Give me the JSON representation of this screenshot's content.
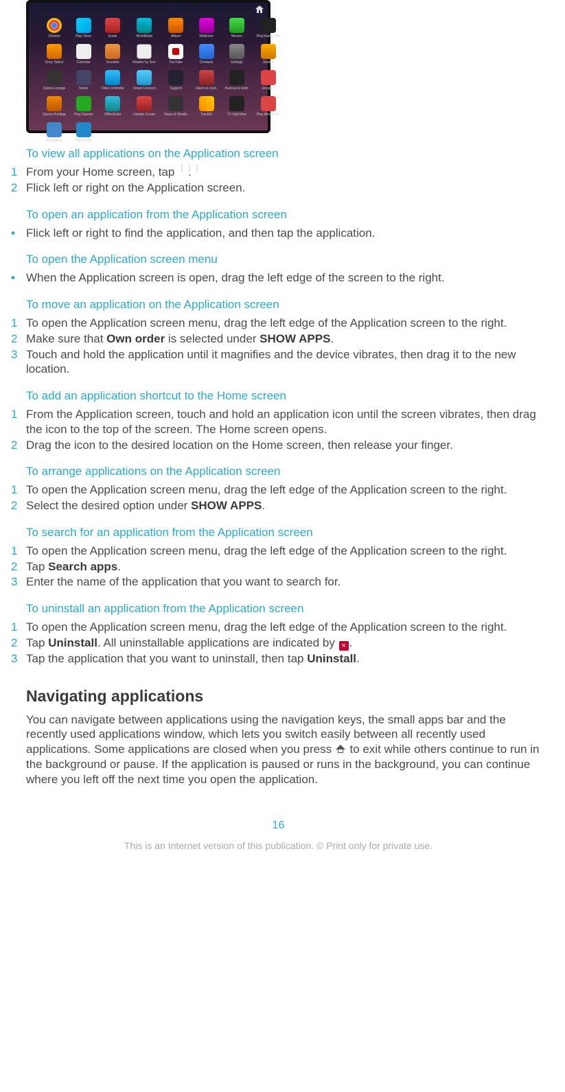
{
  "screenshot": {
    "apps": [
      {
        "label": "Chrome",
        "cls": "ico-chrome"
      },
      {
        "label": "Play Store",
        "cls": "ico-play"
      },
      {
        "label": "Email",
        "cls": "ico-email"
      },
      {
        "label": "WorldMate",
        "cls": "ico-worldmate"
      },
      {
        "label": "Album",
        "cls": "ico-album"
      },
      {
        "label": "Walkman",
        "cls": "ico-walkman"
      },
      {
        "label": "Movies",
        "cls": "ico-movies"
      },
      {
        "label": "PlayStation Mobile",
        "cls": "ico-psmobile"
      },
      {
        "label": "Sony Select",
        "cls": "ico-sonysel"
      },
      {
        "label": "Calendar",
        "cls": "ico-calendar"
      },
      {
        "label": "Socialife",
        "cls": "ico-socialife"
      },
      {
        "label": "Reader by Sony",
        "cls": "ico-ebook"
      },
      {
        "label": "YouTube",
        "cls": "ico-youtube"
      },
      {
        "label": "Contacts",
        "cls": "ico-contacts"
      },
      {
        "label": "Settings",
        "cls": "ico-settings"
      },
      {
        "label": "Sketch",
        "cls": "ico-sketch"
      },
      {
        "label": "Xperia Lounge",
        "cls": "ico-dark1"
      },
      {
        "label": "Notes",
        "cls": "ico-dark2"
      },
      {
        "label": "Video Unlimited",
        "cls": "ico-vu"
      },
      {
        "label": "Smart Connect",
        "cls": "ico-smartcon"
      },
      {
        "label": "Support",
        "cls": "ico-support"
      },
      {
        "label": "Alarm & clock",
        "cls": "ico-alarm"
      },
      {
        "label": "Backup & restore",
        "cls": "ico-backup"
      },
      {
        "label": "Google+",
        "cls": "ico-gplus"
      },
      {
        "label": "Xperia Privilege",
        "cls": "ico-xprivacy"
      },
      {
        "label": "Play Games",
        "cls": "ico-playgames"
      },
      {
        "label": "OfficeSuite",
        "cls": "ico-officesuite"
      },
      {
        "label": "Update Center",
        "cls": "ico-micro"
      },
      {
        "label": "News & Weather",
        "cls": "ico-news"
      },
      {
        "label": "TrackID",
        "cls": "ico-trackid"
      },
      {
        "label": "TV SideView",
        "cls": "ico-tvsidev"
      },
      {
        "label": "Play Movies & TV",
        "cls": "ico-playmovies"
      },
      {
        "label": "Navigation",
        "cls": "ico-nav"
      },
      {
        "label": "Play Books",
        "cls": "ico-playbooks"
      }
    ]
  },
  "sections": {
    "view_all": {
      "title": "To view all applications on the Application screen",
      "s1_num": "1",
      "s1_a": "From your Home screen, tap ",
      "s1_b": ".",
      "s2_num": "2",
      "s2": "Flick left or right on the Application screen."
    },
    "open_app": {
      "title": "To open an application from the Application screen",
      "b1": "Flick left or right to find the application, and then tap the application."
    },
    "open_menu": {
      "title": "To open the Application screen menu",
      "b1": "When the Application screen is open, drag the left edge of the screen to the right."
    },
    "move_app": {
      "title": "To move an application on the Application screen",
      "s1_num": "1",
      "s1": "To open the Application screen menu, drag the left edge of the Application screen to the right.",
      "s2_num": "2",
      "s2_a": "Make sure that ",
      "s2_bold1": "Own order",
      "s2_b": " is selected under ",
      "s2_bold2": "SHOW APPS",
      "s2_c": ".",
      "s3_num": "3",
      "s3": "Touch and hold the application until it magnifies and the device vibrates, then drag it to the new location."
    },
    "add_shortcut": {
      "title": "To add an application shortcut to the Home screen",
      "s1_num": "1",
      "s1": "From the Application screen, touch and hold an application icon until the screen vibrates, then drag the icon to the top of the screen. The Home screen opens.",
      "s2_num": "2",
      "s2": "Drag the icon to the desired location on the Home screen, then release your finger."
    },
    "arrange": {
      "title": "To arrange applications on the Application screen",
      "s1_num": "1",
      "s1": "To open the Application screen menu, drag the left edge of the Application screen to the right.",
      "s2_num": "2",
      "s2_a": "Select the desired option under ",
      "s2_bold": "SHOW APPS",
      "s2_b": "."
    },
    "search": {
      "title": "To search for an application from the Application screen",
      "s1_num": "1",
      "s1": "To open the Application screen menu, drag the left edge of the Application screen to the right.",
      "s2_num": "2",
      "s2_a": "Tap ",
      "s2_bold": "Search apps",
      "s2_b": ".",
      "s3_num": "3",
      "s3": "Enter the name of the application that you want to search for."
    },
    "uninstall": {
      "title": "To uninstall an application from the Application screen",
      "s1_num": "1",
      "s1": "To open the Application screen menu, drag the left edge of the Application screen to the right.",
      "s2_num": "2",
      "s2_a": "Tap ",
      "s2_bold": "Uninstall",
      "s2_b": ". All uninstallable applications are indicated by ",
      "s2_c": ".",
      "s3_num": "3",
      "s3_a": "Tap the application that you want to uninstall, then tap ",
      "s3_bold": "Uninstall",
      "s3_b": "."
    }
  },
  "navigating": {
    "title": "Navigating applications",
    "para_a": "You can navigate between applications using the navigation keys, the small apps bar and the recently used applications window, which lets you switch easily between all recently used applications. Some applications are closed when you press ",
    "para_b": " to exit while others continue to run in the background or pause. If the application is paused or runs in the background, you can continue where you left off the next time you open the application."
  },
  "page_number": "16",
  "footer": "This is an Internet version of this publication. © Print only for private use."
}
